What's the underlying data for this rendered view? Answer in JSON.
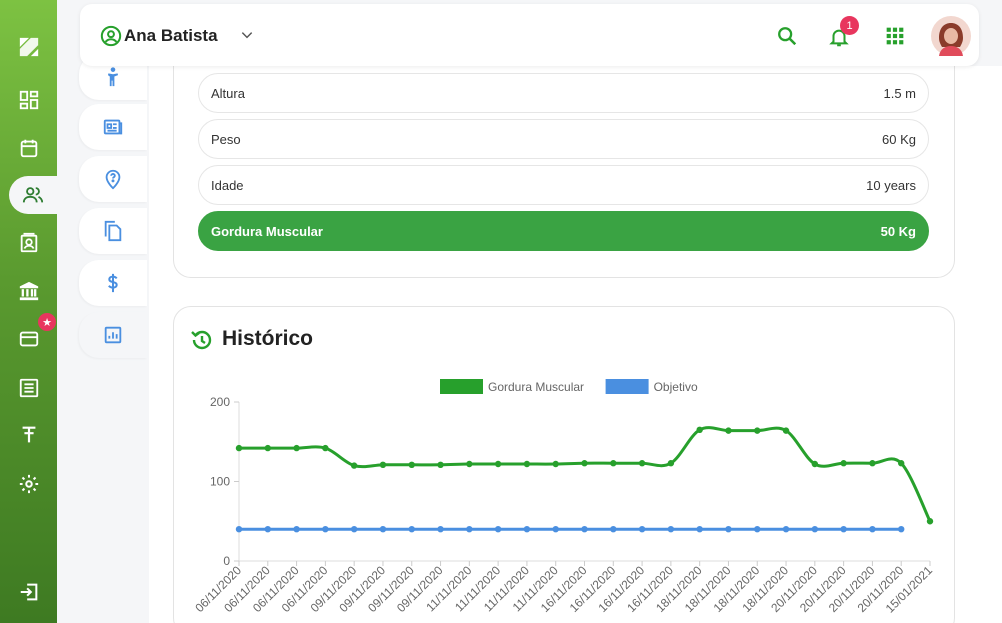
{
  "user": {
    "name": "Ana Batista"
  },
  "notifications": {
    "count": "1"
  },
  "measures": [
    {
      "label": "Altura",
      "value": "1.5 m"
    },
    {
      "label": "Peso",
      "value": "60 Kg"
    },
    {
      "label": "Idade",
      "value": "10 years"
    },
    {
      "label": "Gordura Muscular",
      "value": "50 Kg"
    }
  ],
  "history": {
    "title": "Histórico"
  },
  "chart_data": {
    "type": "line",
    "x": [
      "06/11/2020",
      "06/11/2020",
      "06/11/2020",
      "06/11/2020",
      "09/11/2020",
      "09/11/2020",
      "09/11/2020",
      "09/11/2020",
      "11/11/2020",
      "11/11/2020",
      "11/11/2020",
      "11/11/2020",
      "16/11/2020",
      "16/11/2020",
      "16/11/2020",
      "16/11/2020",
      "18/11/2020",
      "18/11/2020",
      "18/11/2020",
      "18/11/2020",
      "20/11/2020",
      "20/11/2020",
      "20/11/2020",
      "20/11/2020",
      "15/01/2021"
    ],
    "series": [
      {
        "name": "Gordura Muscular",
        "color": "#27a02c",
        "values": [
          142,
          142,
          142,
          142,
          120,
          121,
          121,
          121,
          122,
          122,
          122,
          122,
          123,
          123,
          123,
          123,
          165,
          164,
          164,
          164,
          122,
          123,
          123,
          123,
          50
        ]
      },
      {
        "name": "Objetivo",
        "color": "#4a8fe0",
        "values": [
          40,
          40,
          40,
          40,
          40,
          40,
          40,
          40,
          40,
          40,
          40,
          40,
          40,
          40,
          40,
          40,
          40,
          40,
          40,
          40,
          40,
          40,
          40,
          40,
          null
        ]
      }
    ],
    "yticks": [
      "0",
      "100",
      "200"
    ],
    "ylim": [
      0,
      200
    ],
    "legend": "top"
  },
  "colors": {
    "brand_green": "#3aa343",
    "icon_blue": "#4a8fe0",
    "badge_red": "#e8365e"
  }
}
